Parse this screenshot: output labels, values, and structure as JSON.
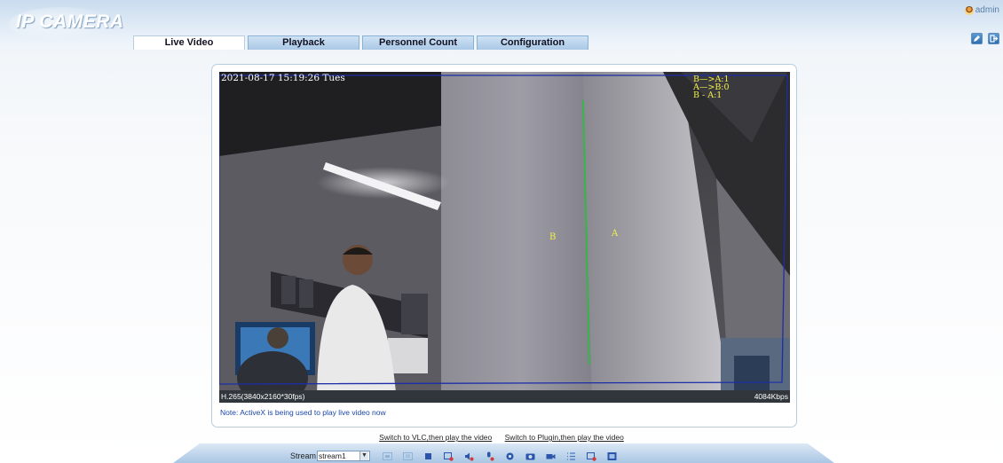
{
  "app": {
    "logo_text": "IP CAMERA",
    "user": "admin"
  },
  "tabs": [
    {
      "label": "Live Video",
      "active": true
    },
    {
      "label": "Playback",
      "active": false
    },
    {
      "label": "Personnel Count",
      "active": false
    },
    {
      "label": "Configuration",
      "active": false
    }
  ],
  "header_buttons": {
    "edit": "edit-icon",
    "logout": "logout-icon"
  },
  "video": {
    "timestamp": "2021-08-17 15:19:26 Tues",
    "counts": [
      "B—>A:1",
      "A—>B:0",
      "B - A:1"
    ],
    "line_label_a": "A",
    "line_label_b": "B",
    "resolution": "H.265(3840x2160*30fps)",
    "bitrate": "4084Kbps"
  },
  "note": "Note: ActiveX is being used to play live video now",
  "links": {
    "vlc": "Switch to VLC,then play the video",
    "plugin": "Switch to Plugin,then play the video"
  },
  "toolbar": {
    "stream_label": "Stream",
    "stream_value": "stream1",
    "icons": [
      "fit-window-icon",
      "original-size-icon",
      "stop-icon",
      "record-icon",
      "audio-icon",
      "talk-icon",
      "settings-icon",
      "snapshot-icon",
      "camera-record-icon",
      "list-icon",
      "zoom-icon",
      "fullscreen-icon"
    ]
  },
  "colors": {
    "accent": "#2f6fae",
    "osd_yellow": "#f1f04a",
    "count_line": "#22c33a",
    "roi_border": "#1b2ea8"
  }
}
